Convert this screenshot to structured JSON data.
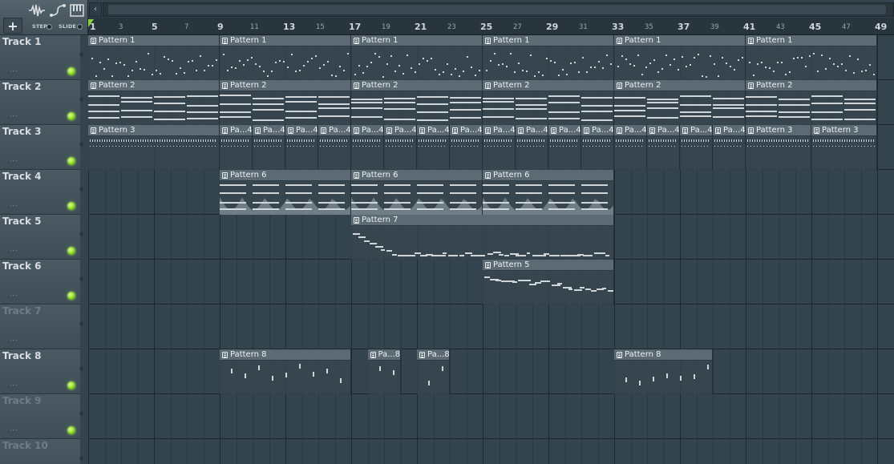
{
  "toolbar": {
    "add_label": "+",
    "step_label": "STEP",
    "slide_label": "SLIDE",
    "scroll_left": "‹",
    "icons": [
      "waveform-icon",
      "slide-curve-icon",
      "piano-keys-icon"
    ]
  },
  "ruler": {
    "major": [
      "1",
      "5",
      "9",
      "13",
      "17",
      "21",
      "25",
      "29",
      "33",
      "37",
      "41",
      "45",
      "49"
    ],
    "minor": [
      "3",
      "7",
      "11",
      "15",
      "19",
      "23",
      "27",
      "31",
      "35",
      "39",
      "43",
      "47"
    ]
  },
  "tracks": [
    {
      "name": "Track 1",
      "muted": false,
      "led": true
    },
    {
      "name": "Track 2",
      "muted": false,
      "led": true
    },
    {
      "name": "Track 3",
      "muted": false,
      "led": true
    },
    {
      "name": "Track 4",
      "muted": false,
      "led": true
    },
    {
      "name": "Track 5",
      "muted": false,
      "led": true
    },
    {
      "name": "Track 6",
      "muted": false,
      "led": true
    },
    {
      "name": "Track 7",
      "muted": true,
      "led": false
    },
    {
      "name": "Track 8",
      "muted": false,
      "led": true
    },
    {
      "name": "Track 9",
      "muted": true,
      "led": true
    },
    {
      "name": "Track 10",
      "muted": true,
      "led": false
    }
  ],
  "clips": [
    {
      "track": 0,
      "start": 1,
      "len": 8,
      "label": "Pattern 1",
      "kind": "dots"
    },
    {
      "track": 0,
      "start": 9,
      "len": 8,
      "label": "Pattern 1",
      "kind": "dots"
    },
    {
      "track": 0,
      "start": 17,
      "len": 8,
      "label": "Pattern 1",
      "kind": "dots"
    },
    {
      "track": 0,
      "start": 25,
      "len": 8,
      "label": "Pattern 1",
      "kind": "dots"
    },
    {
      "track": 0,
      "start": 33,
      "len": 8,
      "label": "Pattern 1",
      "kind": "dots"
    },
    {
      "track": 0,
      "start": 41,
      "len": 8,
      "label": "Pattern 1",
      "kind": "dots"
    },
    {
      "track": 1,
      "start": 1,
      "len": 8,
      "label": "Pattern 2",
      "kind": "chords"
    },
    {
      "track": 1,
      "start": 9,
      "len": 8,
      "label": "Pattern 2",
      "kind": "chords"
    },
    {
      "track": 1,
      "start": 17,
      "len": 8,
      "label": "Pattern 2",
      "kind": "chords"
    },
    {
      "track": 1,
      "start": 25,
      "len": 8,
      "label": "Pattern 2",
      "kind": "chords"
    },
    {
      "track": 1,
      "start": 33,
      "len": 8,
      "label": "Pattern 2",
      "kind": "chords"
    },
    {
      "track": 1,
      "start": 41,
      "len": 8,
      "label": "Pattern 2",
      "kind": "chords"
    },
    {
      "track": 2,
      "start": 1,
      "len": 8,
      "label": "Pattern 3",
      "kind": "hats"
    },
    {
      "track": 2,
      "start": 9,
      "len": 2,
      "label": "Pa...4",
      "kind": "hats"
    },
    {
      "track": 2,
      "start": 11,
      "len": 2,
      "label": "Pa...4",
      "kind": "hats"
    },
    {
      "track": 2,
      "start": 13,
      "len": 2,
      "label": "Pa...4",
      "kind": "hats"
    },
    {
      "track": 2,
      "start": 15,
      "len": 2,
      "label": "Pa...4",
      "kind": "hats"
    },
    {
      "track": 2,
      "start": 17,
      "len": 2,
      "label": "Pa...4",
      "kind": "hats"
    },
    {
      "track": 2,
      "start": 19,
      "len": 2,
      "label": "Pa...4",
      "kind": "hats"
    },
    {
      "track": 2,
      "start": 21,
      "len": 2,
      "label": "Pa...4",
      "kind": "hats"
    },
    {
      "track": 2,
      "start": 23,
      "len": 2,
      "label": "Pa...4",
      "kind": "hats"
    },
    {
      "track": 2,
      "start": 25,
      "len": 2,
      "label": "Pa...4",
      "kind": "hats"
    },
    {
      "track": 2,
      "start": 27,
      "len": 2,
      "label": "Pa...4",
      "kind": "hats"
    },
    {
      "track": 2,
      "start": 29,
      "len": 2,
      "label": "Pa...4",
      "kind": "hats"
    },
    {
      "track": 2,
      "start": 31,
      "len": 2,
      "label": "Pa...4",
      "kind": "hats"
    },
    {
      "track": 2,
      "start": 33,
      "len": 2,
      "label": "Pa...4",
      "kind": "hats"
    },
    {
      "track": 2,
      "start": 35,
      "len": 2,
      "label": "Pa...4",
      "kind": "hats"
    },
    {
      "track": 2,
      "start": 37,
      "len": 2,
      "label": "Pa...4",
      "kind": "hats"
    },
    {
      "track": 2,
      "start": 39,
      "len": 2,
      "label": "Pa...4",
      "kind": "hats"
    },
    {
      "track": 2,
      "start": 41,
      "len": 4,
      "label": "Pattern 3",
      "kind": "hats"
    },
    {
      "track": 2,
      "start": 45,
      "len": 4,
      "label": "Pattern 3",
      "kind": "hats"
    },
    {
      "track": 3,
      "start": 9,
      "len": 8,
      "label": "Pattern 6",
      "kind": "wave"
    },
    {
      "track": 3,
      "start": 17,
      "len": 8,
      "label": "Pattern 6",
      "kind": "wave"
    },
    {
      "track": 3,
      "start": 25,
      "len": 8,
      "label": "Pattern 6",
      "kind": "wave"
    },
    {
      "track": 4,
      "start": 17,
      "len": 16,
      "label": "Pattern 7",
      "kind": "melody"
    },
    {
      "track": 5,
      "start": 25,
      "len": 8,
      "label": "Pattern 5",
      "kind": "melody"
    },
    {
      "track": 7,
      "start": 9,
      "len": 8,
      "label": "Pattern 8",
      "kind": "perc"
    },
    {
      "track": 7,
      "start": 18,
      "len": 2,
      "label": "Pa...8",
      "kind": "perc"
    },
    {
      "track": 7,
      "start": 21,
      "len": 2,
      "label": "Pa...8",
      "kind": "perc"
    },
    {
      "track": 7,
      "start": 33,
      "len": 6,
      "label": "Pattern 8",
      "kind": "perc"
    }
  ]
}
